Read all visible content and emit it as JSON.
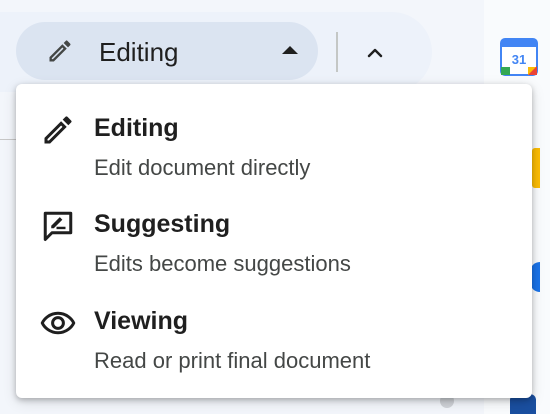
{
  "mode_button": {
    "label": "Editing",
    "icon": "pencil-icon"
  },
  "collapse_button": {
    "icon": "chevron-up-icon"
  },
  "calendar": {
    "icon": "google-calendar-icon",
    "day": "31"
  },
  "menu": {
    "items": [
      {
        "title": "Editing",
        "description": "Edit document directly",
        "icon": "pencil-icon"
      },
      {
        "title": "Suggesting",
        "description": "Edits become suggestions",
        "icon": "suggest-edit-icon"
      },
      {
        "title": "Viewing",
        "description": "Read or print final document",
        "icon": "eye-icon"
      }
    ]
  },
  "colors": {
    "mode_button_bg": "#dbe4f1",
    "menu_bg": "#ffffff",
    "text_primary": "#1f1f1f",
    "text_secondary": "#444746"
  }
}
